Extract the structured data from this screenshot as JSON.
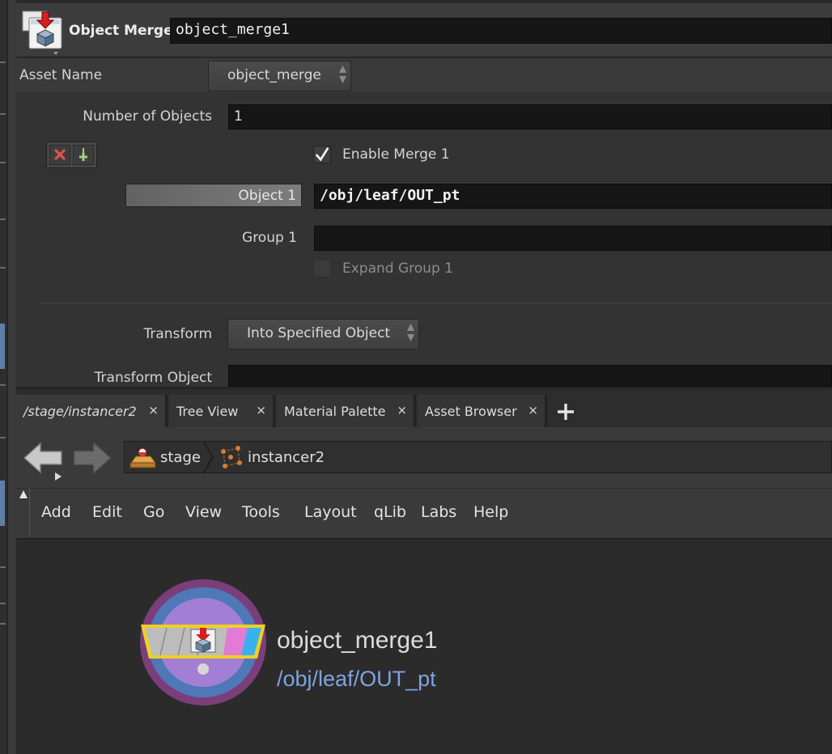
{
  "colors": {
    "panel_bg": "#3a3a3a",
    "field_bg": "#161616",
    "network_bg": "#2b2b2b",
    "node_path_link": "#7da4e0",
    "node_ring_outer": "#7a3f7a",
    "node_ring_mid": "#4f78b8",
    "node_ring_inner": "#a27fd4",
    "node_highlight": "#f0d020"
  },
  "header": {
    "node_type_icon": "object-merge-icon",
    "node_type_label": "Object Merge",
    "node_name": "object_merge1"
  },
  "params": {
    "asset_name_label": "Asset Name",
    "asset_name_value": "object_merge",
    "num_objects_label": "Number of Objects",
    "num_objects_value": "1",
    "remove_icon": "remove-x-icon",
    "add_icon": "insert-plus-icon",
    "enable_merge_label": "Enable Merge 1",
    "enable_merge_checked": true,
    "object_label": "Object 1",
    "object_value": "/obj/leaf/OUT_pt",
    "group_label": "Group 1",
    "group_value": "",
    "expand_group_label": "Expand Group 1",
    "expand_group_checked": false,
    "transform_label": "Transform",
    "transform_value": "Into Specified Object",
    "transform_object_label": "Transform Object"
  },
  "tabs": [
    {
      "label": "/stage/instancer2",
      "close": "×"
    },
    {
      "label": "Tree View",
      "close": "×"
    },
    {
      "label": "Material Palette",
      "close": "×"
    },
    {
      "label": "Asset Browser",
      "close": "×"
    }
  ],
  "add_tab_icon": "plus-icon",
  "pathbar": {
    "back_icon": "back-arrow-icon",
    "forward_icon": "forward-arrow-icon",
    "crumbs": [
      {
        "label": "stage",
        "icon": "stage-icon"
      },
      {
        "label": "instancer2",
        "icon": "instancer-icon"
      }
    ]
  },
  "menubar": [
    "Add",
    "Edit",
    "Go",
    "View",
    "Tools",
    "Layout",
    "qLib",
    "Labs",
    "Help"
  ],
  "network": {
    "node_name": "object_merge1",
    "node_path": "/obj/leaf/OUT_pt"
  }
}
